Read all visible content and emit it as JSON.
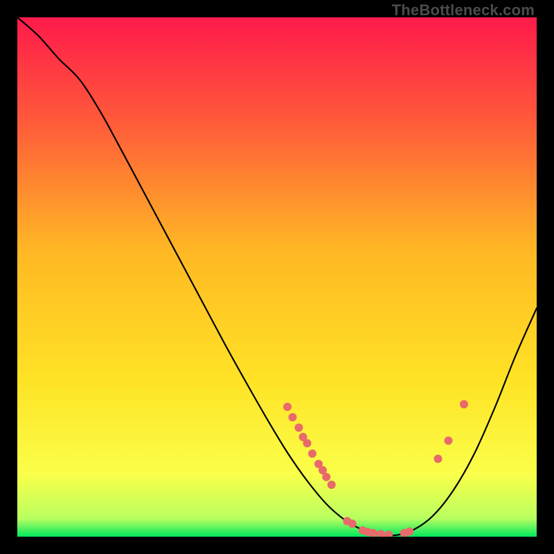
{
  "watermark": "TheBottleneck.com",
  "chart_data": {
    "type": "line",
    "title": "",
    "xlabel": "",
    "ylabel": "",
    "xlim": [
      0,
      100
    ],
    "ylim": [
      0,
      100
    ],
    "gradient_stops": [
      {
        "offset": 0.0,
        "color": "#ff1a4b"
      },
      {
        "offset": 0.2,
        "color": "#ff5a3a"
      },
      {
        "offset": 0.45,
        "color": "#ffb824"
      },
      {
        "offset": 0.7,
        "color": "#ffe325"
      },
      {
        "offset": 0.88,
        "color": "#faff4a"
      },
      {
        "offset": 0.965,
        "color": "#b8ff60"
      },
      {
        "offset": 1.0,
        "color": "#00e85e"
      }
    ],
    "curve": [
      {
        "x": 0.0,
        "y": 100.0
      },
      {
        "x": 4.0,
        "y": 96.5
      },
      {
        "x": 8.0,
        "y": 92.0
      },
      {
        "x": 12.0,
        "y": 88.0
      },
      {
        "x": 16.0,
        "y": 81.8
      },
      {
        "x": 20.0,
        "y": 74.5
      },
      {
        "x": 24.0,
        "y": 67.0
      },
      {
        "x": 28.0,
        "y": 59.5
      },
      {
        "x": 32.0,
        "y": 52.0
      },
      {
        "x": 36.0,
        "y": 44.5
      },
      {
        "x": 40.0,
        "y": 37.0
      },
      {
        "x": 44.0,
        "y": 29.8
      },
      {
        "x": 48.0,
        "y": 22.8
      },
      {
        "x": 52.0,
        "y": 16.2
      },
      {
        "x": 56.0,
        "y": 10.5
      },
      {
        "x": 60.0,
        "y": 5.8
      },
      {
        "x": 64.0,
        "y": 2.6
      },
      {
        "x": 68.0,
        "y": 0.8
      },
      {
        "x": 72.0,
        "y": 0.2
      },
      {
        "x": 76.0,
        "y": 1.2
      },
      {
        "x": 80.0,
        "y": 4.0
      },
      {
        "x": 84.0,
        "y": 9.0
      },
      {
        "x": 88.0,
        "y": 16.0
      },
      {
        "x": 92.0,
        "y": 25.0
      },
      {
        "x": 96.0,
        "y": 35.0
      },
      {
        "x": 100.0,
        "y": 44.0
      }
    ],
    "markers": [
      {
        "x": 52.0,
        "y": 25.0
      },
      {
        "x": 53.0,
        "y": 23.0
      },
      {
        "x": 54.2,
        "y": 21.0
      },
      {
        "x": 55.0,
        "y": 19.2
      },
      {
        "x": 55.8,
        "y": 18.0
      },
      {
        "x": 56.8,
        "y": 16.0
      },
      {
        "x": 58.0,
        "y": 14.0
      },
      {
        "x": 58.8,
        "y": 12.8
      },
      {
        "x": 59.5,
        "y": 11.5
      },
      {
        "x": 60.5,
        "y": 10.0
      },
      {
        "x": 63.5,
        "y": 3.0
      },
      {
        "x": 64.5,
        "y": 2.5
      },
      {
        "x": 66.5,
        "y": 1.2
      },
      {
        "x": 67.5,
        "y": 0.9
      },
      {
        "x": 68.5,
        "y": 0.7
      },
      {
        "x": 70.0,
        "y": 0.5
      },
      {
        "x": 71.5,
        "y": 0.4
      },
      {
        "x": 74.5,
        "y": 0.7
      },
      {
        "x": 75.5,
        "y": 1.0
      },
      {
        "x": 81.0,
        "y": 15.0
      },
      {
        "x": 83.0,
        "y": 18.5
      },
      {
        "x": 86.0,
        "y": 25.5
      }
    ],
    "marker_color": "#e86a6a",
    "marker_radius": 6
  }
}
